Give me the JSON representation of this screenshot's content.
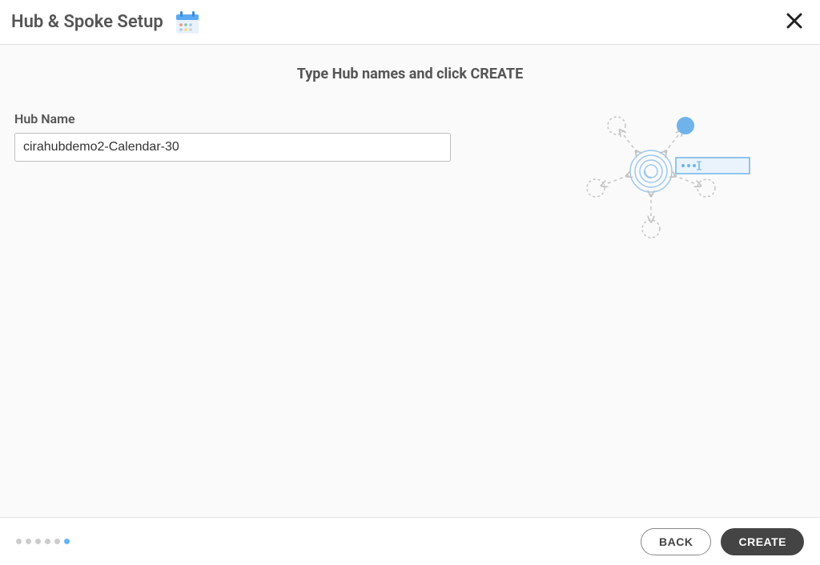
{
  "header": {
    "title": "Hub & Spoke Setup"
  },
  "instruction": "Type Hub names and click CREATE",
  "form": {
    "hub_name_label": "Hub Name",
    "hub_name_value": "cirahubdemo2-Calendar-30"
  },
  "footer": {
    "back_label": "BACK",
    "create_label": "CREATE",
    "total_steps": 6,
    "active_step": 6
  }
}
